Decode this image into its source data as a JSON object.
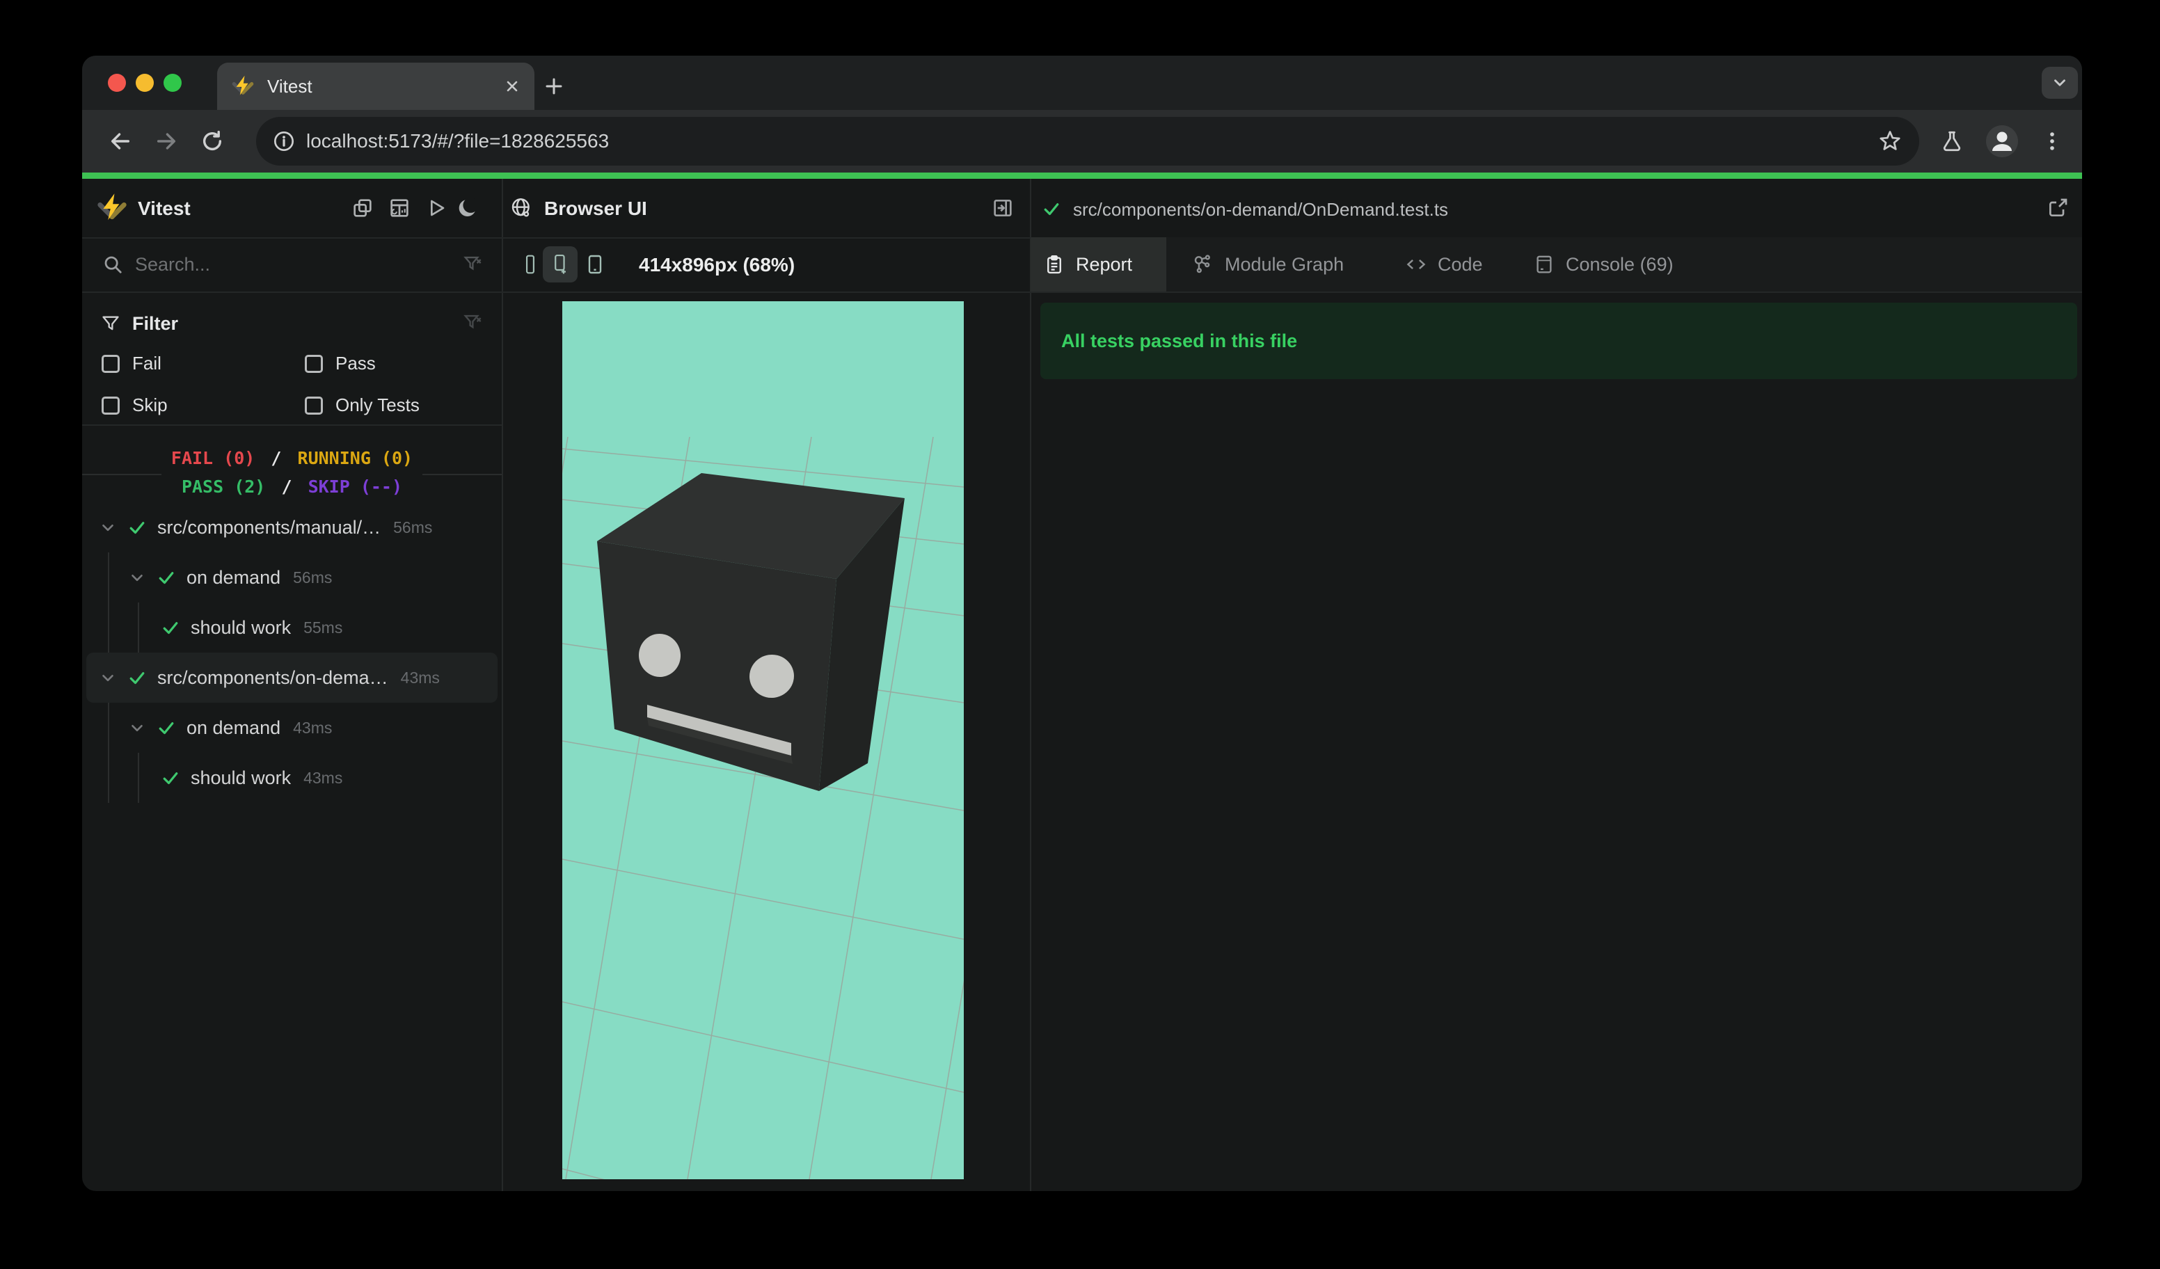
{
  "browser": {
    "tab_title": "Vitest",
    "url": "localhost:5173/#/?file=1828625563"
  },
  "sidebar": {
    "title": "Vitest",
    "search_placeholder": "Search...",
    "filter": {
      "title": "Filter",
      "options": [
        "Fail",
        "Pass",
        "Skip",
        "Only Tests"
      ]
    },
    "summary": {
      "fail": "FAIL (0)",
      "running": "RUNNING (0)",
      "pass": "PASS (2)",
      "skip": "SKIP (--)",
      "sep": "/"
    },
    "tree": [
      {
        "label": "src/components/manual/…",
        "time": "56ms"
      },
      {
        "label": "on demand",
        "time": "56ms"
      },
      {
        "label": "should work",
        "time": "55ms"
      },
      {
        "label": "src/components/on-dema…",
        "time": "43ms"
      },
      {
        "label": "on demand",
        "time": "43ms"
      },
      {
        "label": "should work",
        "time": "43ms"
      }
    ]
  },
  "preview": {
    "title": "Browser UI",
    "dimensions": "414x896px (68%)"
  },
  "report": {
    "file_path": "src/components/on-demand/OnDemand.test.ts",
    "tabs": [
      "Report",
      "Module Graph",
      "Code",
      "Console (69)"
    ],
    "banner": "All tests passed in this file"
  },
  "colors": {
    "accent_green": "#3ec153",
    "pass_green": "#35bd67",
    "fail_red": "#e5484d",
    "running_amber": "#dba712",
    "skip_purple": "#7d3fd6",
    "viewport_mint": "#87dcc4",
    "banner_bg": "#14291c",
    "banner_text": "#38d162",
    "logo_yellow": "#fcc72b"
  }
}
